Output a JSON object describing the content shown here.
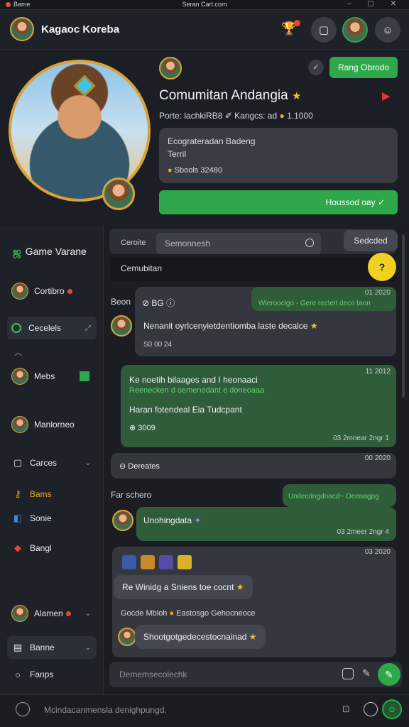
{
  "titlebar": {
    "app": "Bame",
    "title": "Seran Cart.com",
    "controls": "– ▢ ✕"
  },
  "header": {
    "title": "Kagaoc Koreba",
    "trophy_icon": "trophy-icon",
    "badge_color": "#e5463c"
  },
  "hero": {
    "follow_label": "Rang Obrodo",
    "name": "Comumitan Andangia",
    "meta_prefix": "Porte: lachkiRB8",
    "meta_mid": "Kangcs: ad",
    "meta_value": "1.1000",
    "bubble_line1": "Ecograteradan Badeng",
    "bubble_line2": "Terril",
    "bubble_line3": "Sbools 32480",
    "green_bar": "Houssod oay ✓"
  },
  "sidebar": {
    "title": "Game Varane",
    "items": [
      {
        "label": "Cortibro"
      },
      {
        "label": "Cecelels"
      },
      {
        "label": "Mebs"
      },
      {
        "label": "Manlorneo"
      },
      {
        "label": "Carces"
      },
      {
        "label": "Bams"
      },
      {
        "label": "Sonie"
      },
      {
        "label": "Bangl"
      },
      {
        "label": "Alamen"
      },
      {
        "label": "Banne"
      },
      {
        "label": "Fanps"
      }
    ]
  },
  "chat": {
    "bar_label": "Ceroite",
    "search_placeholder": "Semonnesh",
    "select_label": "Sedcded",
    "sub_label": "Cemubitan",
    "fab": "?",
    "m1_label": "Beon",
    "m1_tag": "BG",
    "m1_time": "01 2020",
    "m1_header": "Wierooclgo - Gere recteit deco taon",
    "m1_text": "Nenanit oyrlcenyietdentiomba laste decalce",
    "m1_sub": "S0 00 24",
    "m2_time": "11 2012",
    "m2_line1": "Ke noetih bilaages and I heonaaci",
    "m2_line2": "Reenecken d oemenodant e doneoaaa",
    "m2_line3": "Haran fotendeal Eia Tudcpant",
    "m2_sub": "3009",
    "m2_foot": "03 2mnear 2ngr 1",
    "m3_time": "00 2020",
    "m3_text": "Dereates",
    "m4_label": "Far schero",
    "m4_header": "Unitecdngdnacd~ Oeenagpg",
    "m4_text": "Unohingdata",
    "m4_foot": "03 2meer 2ngr 4",
    "m5_time": "03 2020",
    "m5_pill1": "Re Winidg a Sniens toe cocnt",
    "m5_line": "Gocde Mbloh",
    "m5_line2": "Eastosgo Gehocneoce",
    "m5_pill2": "Shootgotgedecestocnainad",
    "composer_placeholder": "Dememsecolechk"
  },
  "bottom": {
    "text": "Mcindacanmensla denighpungd."
  },
  "colors": {
    "accent": "#2ea84a",
    "gold": "#d9a23a",
    "bg": "#1c1f26"
  }
}
